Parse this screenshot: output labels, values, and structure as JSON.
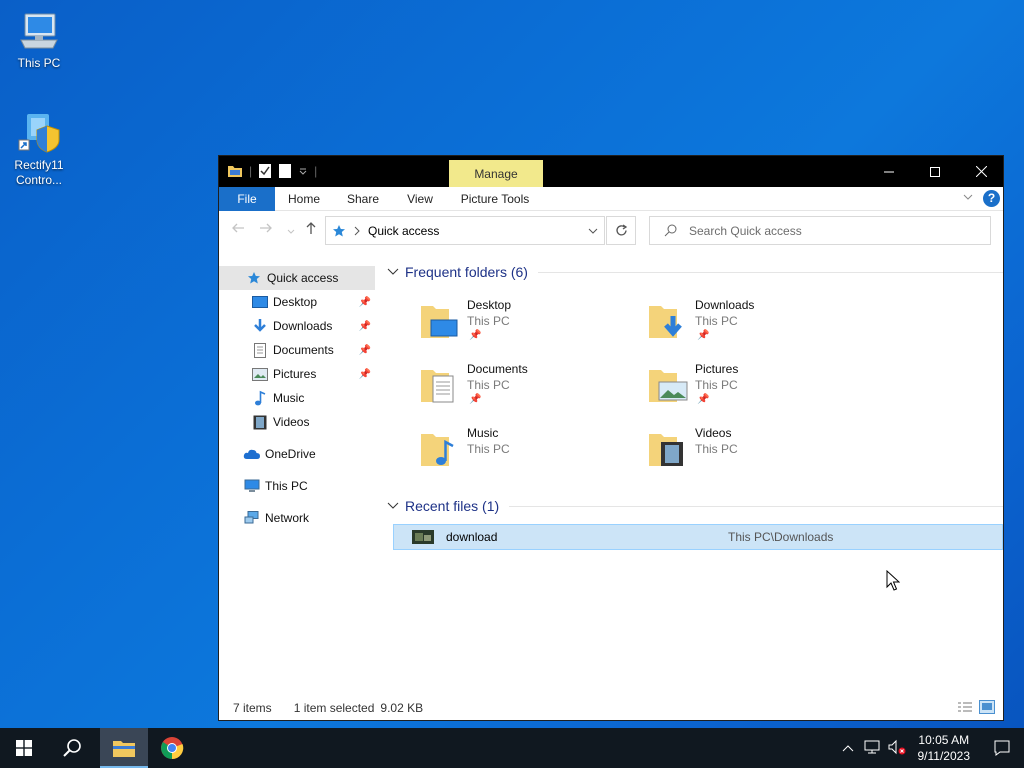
{
  "desktop": {
    "icons": [
      {
        "label": "This PC"
      },
      {
        "label": "Rectify11 Contro..."
      }
    ]
  },
  "window": {
    "manage_tab": "Manage",
    "ribbon_tabs": [
      "File",
      "Home",
      "Share",
      "View",
      "Picture Tools"
    ],
    "address": {
      "location": "Quick access"
    },
    "search": {
      "placeholder": "Search Quick access"
    },
    "nav": [
      {
        "label": "Quick access",
        "pinned": false
      },
      {
        "label": "Desktop",
        "pinned": true
      },
      {
        "label": "Downloads",
        "pinned": true
      },
      {
        "label": "Documents",
        "pinned": true
      },
      {
        "label": "Pictures",
        "pinned": true
      },
      {
        "label": "Music",
        "pinned": false
      },
      {
        "label": "Videos",
        "pinned": false
      },
      {
        "label": "OneDrive",
        "pinned": false
      },
      {
        "label": "This PC",
        "pinned": false
      },
      {
        "label": "Network",
        "pinned": false
      }
    ],
    "frequent_header": "Frequent folders (6)",
    "frequent": [
      {
        "name": "Desktop",
        "location": "This PC",
        "pinned": true
      },
      {
        "name": "Downloads",
        "location": "This PC",
        "pinned": true
      },
      {
        "name": "Documents",
        "location": "This PC",
        "pinned": true
      },
      {
        "name": "Pictures",
        "location": "This PC",
        "pinned": true
      },
      {
        "name": "Music",
        "location": "This PC",
        "pinned": false
      },
      {
        "name": "Videos",
        "location": "This PC",
        "pinned": false
      }
    ],
    "recent_header": "Recent files (1)",
    "recent": [
      {
        "name": "download",
        "path": "This PC\\Downloads"
      }
    ],
    "status": {
      "items": "7 items",
      "selected": "1 item selected",
      "size": "9.02 KB"
    }
  },
  "taskbar": {
    "clock_time": "10:05 AM",
    "clock_date": "9/11/2023"
  },
  "colors": {
    "accent": "#1a6fc9",
    "manage_tab": "#f2e98c",
    "group_header": "#1e3287",
    "selection": "#cce4f7"
  }
}
